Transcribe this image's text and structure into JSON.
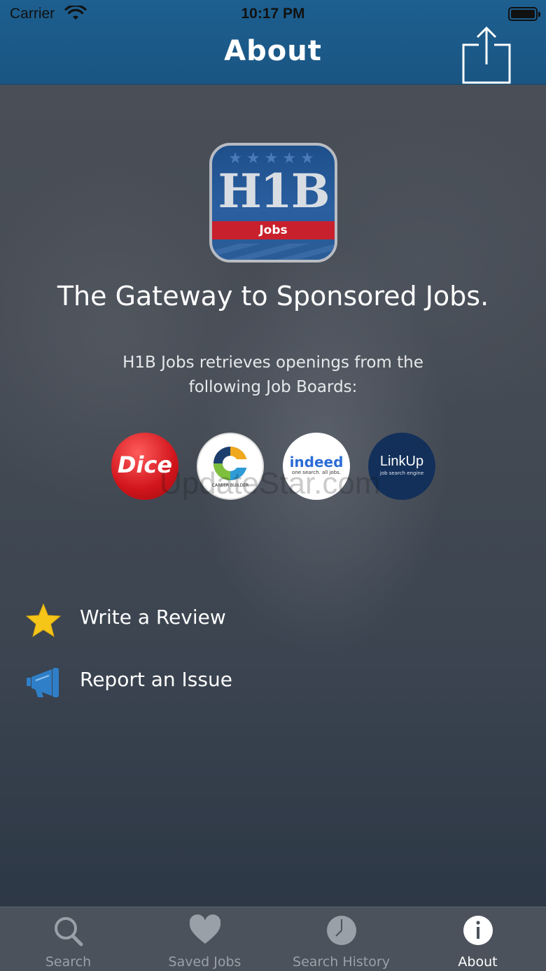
{
  "status_bar": {
    "carrier": "Carrier",
    "time": "10:17 PM"
  },
  "nav": {
    "title": "About"
  },
  "app_icon": {
    "title": "H1B",
    "band": "Jobs"
  },
  "tagline": "The Gateway to Sponsored Jobs.",
  "description": "H1B Jobs retrieves openings from the following Job Boards:",
  "job_boards": [
    {
      "name": "Dice",
      "label": "Dice"
    },
    {
      "name": "CareerBuilder",
      "label": "CAREER BUILDER"
    },
    {
      "name": "Indeed",
      "label": "indeed",
      "sub": "one search. all jobs."
    },
    {
      "name": "LinkUp",
      "label": "LinkUp",
      "sub": "job search engine"
    }
  ],
  "actions": [
    {
      "label": "Write a Review",
      "icon": "star-icon"
    },
    {
      "label": "Report an Issue",
      "icon": "megaphone-icon"
    }
  ],
  "watermark": "UpdateStar.com",
  "tabs": [
    {
      "label": "Search",
      "icon": "search-icon",
      "active": false
    },
    {
      "label": "Saved Jobs",
      "icon": "heart-icon",
      "active": false
    },
    {
      "label": "Search History",
      "icon": "clock-icon",
      "active": false
    },
    {
      "label": "About",
      "icon": "info-icon",
      "active": true
    }
  ],
  "colors": {
    "nav_bar": "#1d5f8f",
    "tab_bar": "#4b525c",
    "star": "#f5c518",
    "megaphone": "#2f7fc8"
  }
}
